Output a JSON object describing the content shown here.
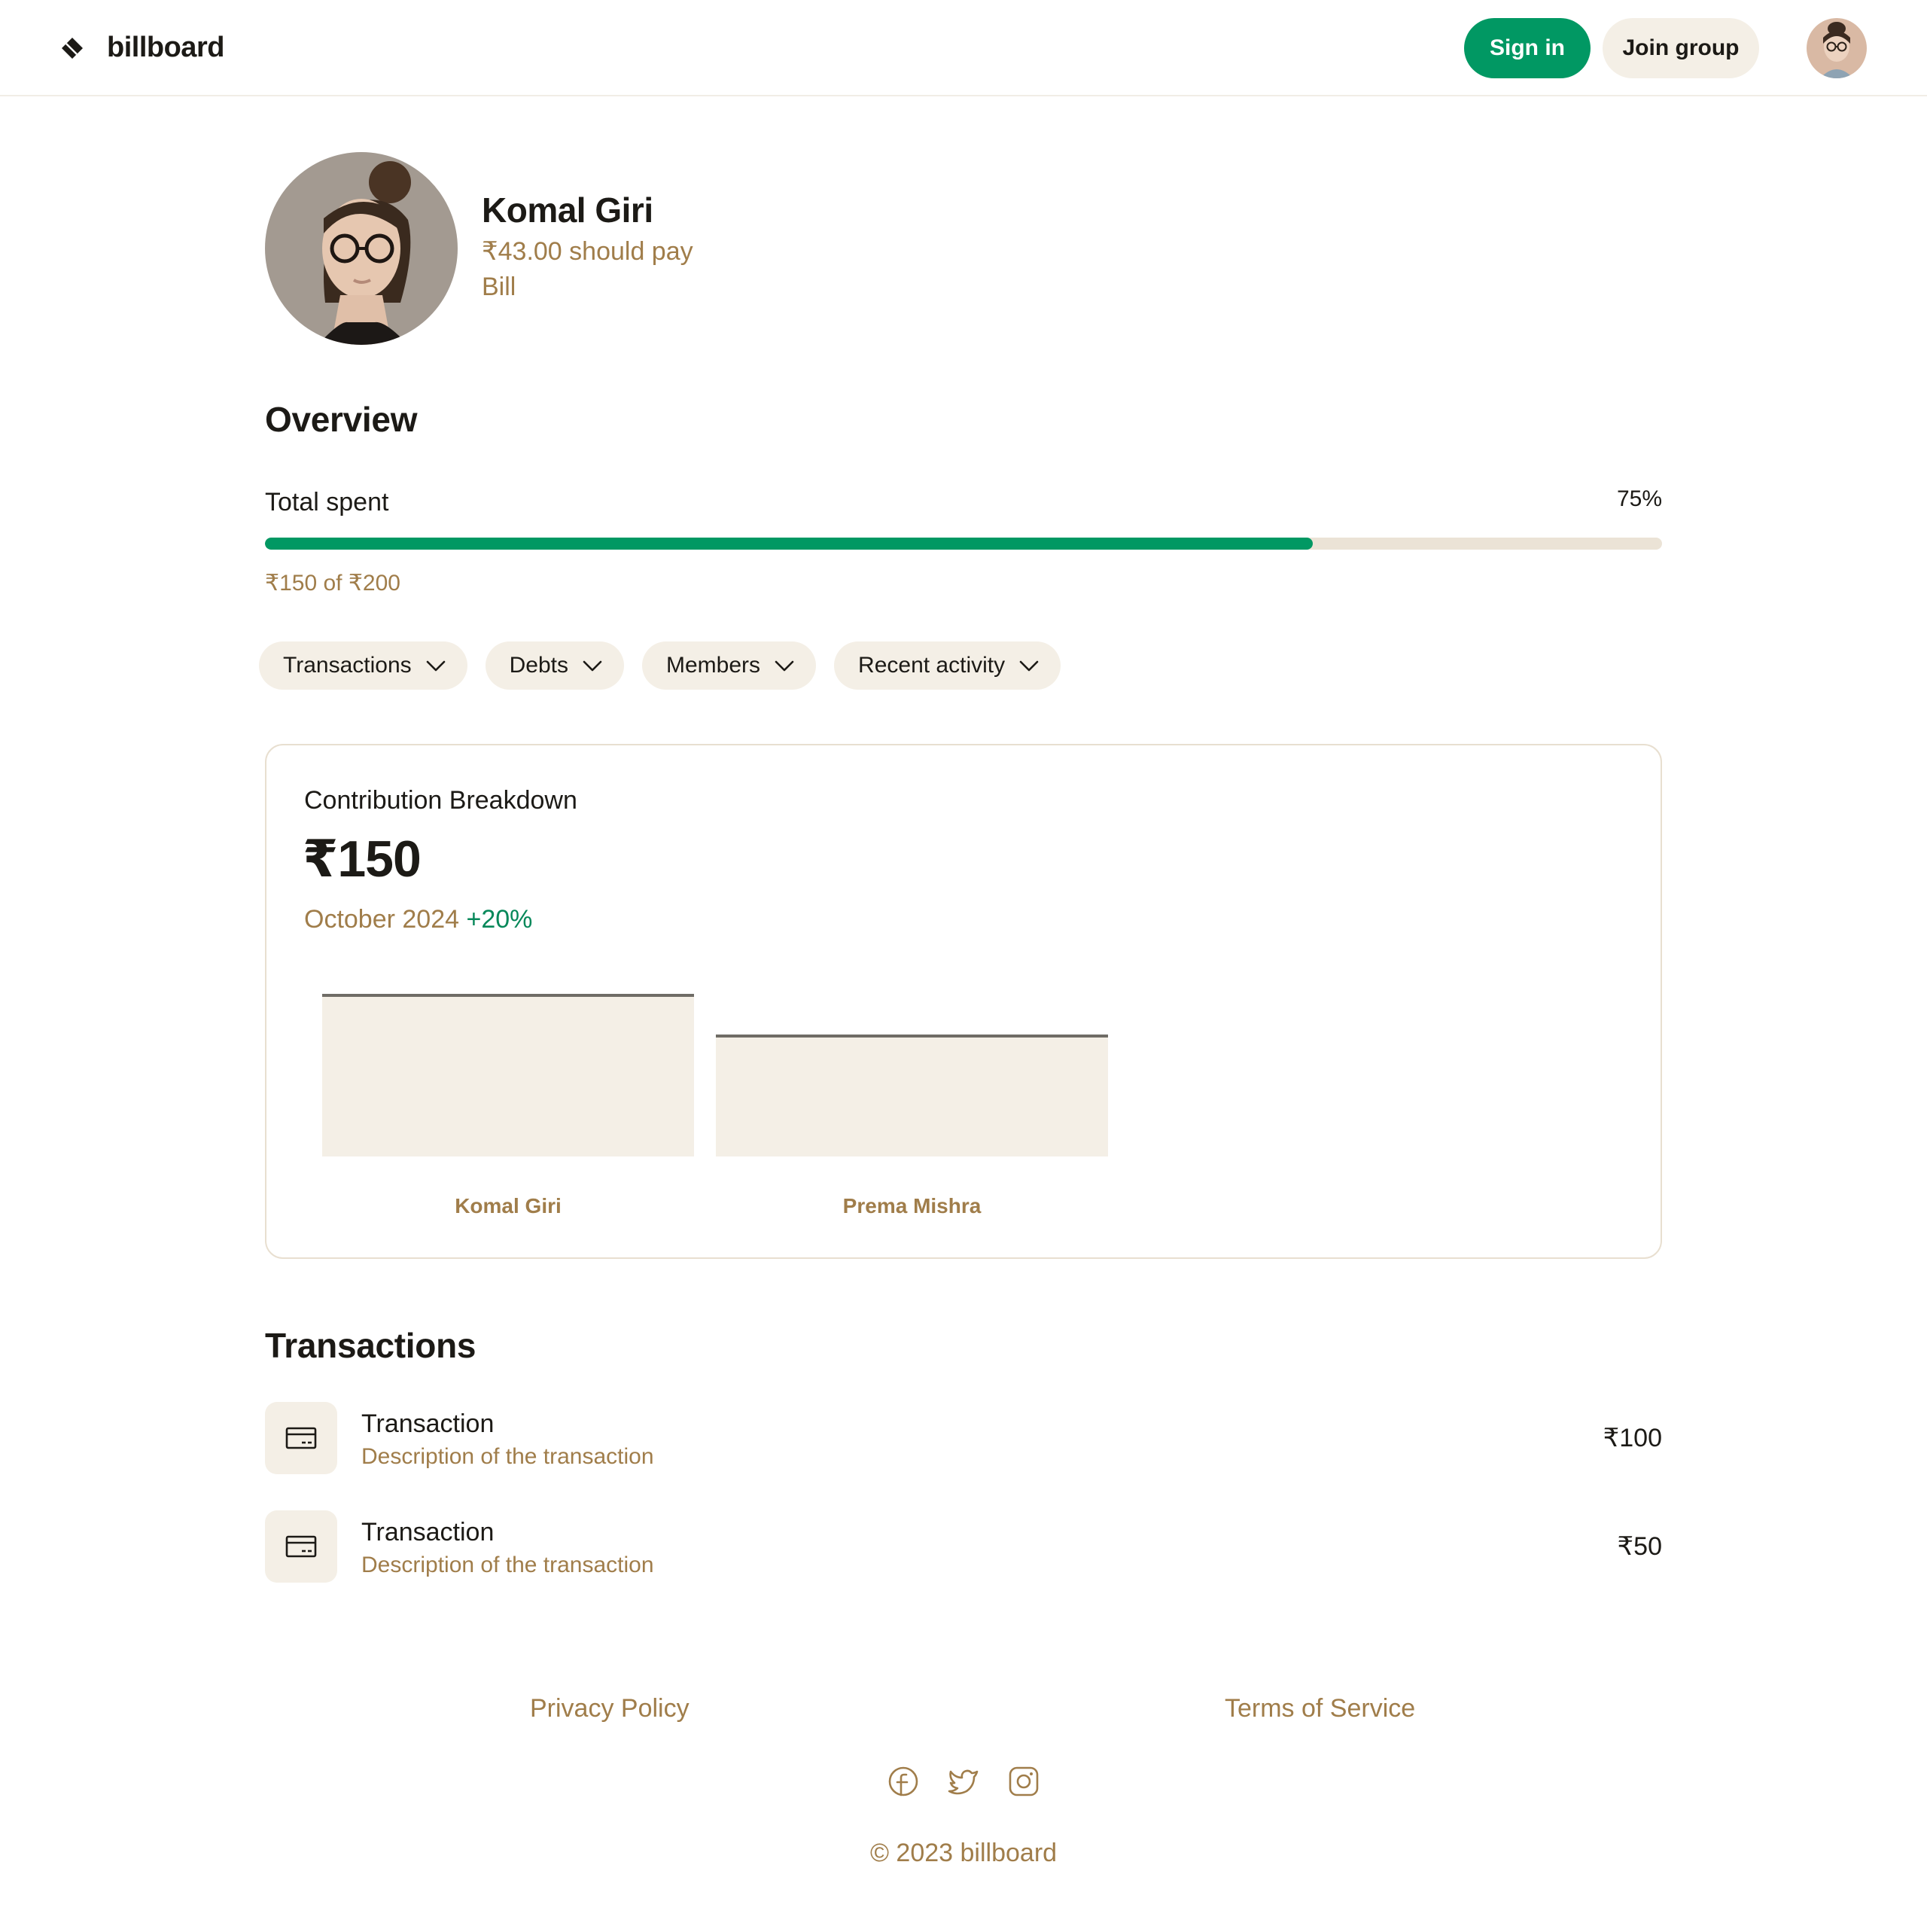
{
  "header": {
    "brand": "billboard",
    "sign_in": "Sign in",
    "join_group": "Join group"
  },
  "profile": {
    "name": "Komal Giri",
    "owes": "₹43.00 should pay",
    "role": "Bill"
  },
  "overview": {
    "title": "Overview",
    "progress_label": "Total spent",
    "progress_percent_text": "75%",
    "progress_fraction": 0.75,
    "progress_caption": "₹150 of ₹200"
  },
  "chips": [
    {
      "label": "Transactions"
    },
    {
      "label": "Debts"
    },
    {
      "label": "Members"
    },
    {
      "label": "Recent activity"
    }
  ],
  "contribution": {
    "title": "Contribution Breakdown",
    "total": "₹150",
    "period": "October 2024",
    "delta": "+20%"
  },
  "chart_data": {
    "type": "bar",
    "categories": [
      "Komal Giri",
      "Prema Mishra"
    ],
    "values": [
      100,
      75
    ],
    "ylim": [
      0,
      100
    ],
    "grid": false
  },
  "transactions": {
    "title": "Transactions",
    "items": [
      {
        "name": "Transaction",
        "description": "Description of the transaction",
        "amount": "₹100"
      },
      {
        "name": "Transaction",
        "description": "Description of the transaction",
        "amount": "₹50"
      }
    ]
  },
  "footer": {
    "privacy": "Privacy Policy",
    "terms": "Terms of Service",
    "copyright": "© 2023 billboard"
  },
  "colors": {
    "accent": "#019863",
    "muted_text": "#a07d4a",
    "chip_bg": "#f4efe6",
    "track": "#ebe3d6"
  },
  "icons": [
    "logo-mark-icon",
    "chevron-down-icon",
    "card-icon",
    "facebook-icon",
    "twitter-icon",
    "instagram-icon"
  ]
}
